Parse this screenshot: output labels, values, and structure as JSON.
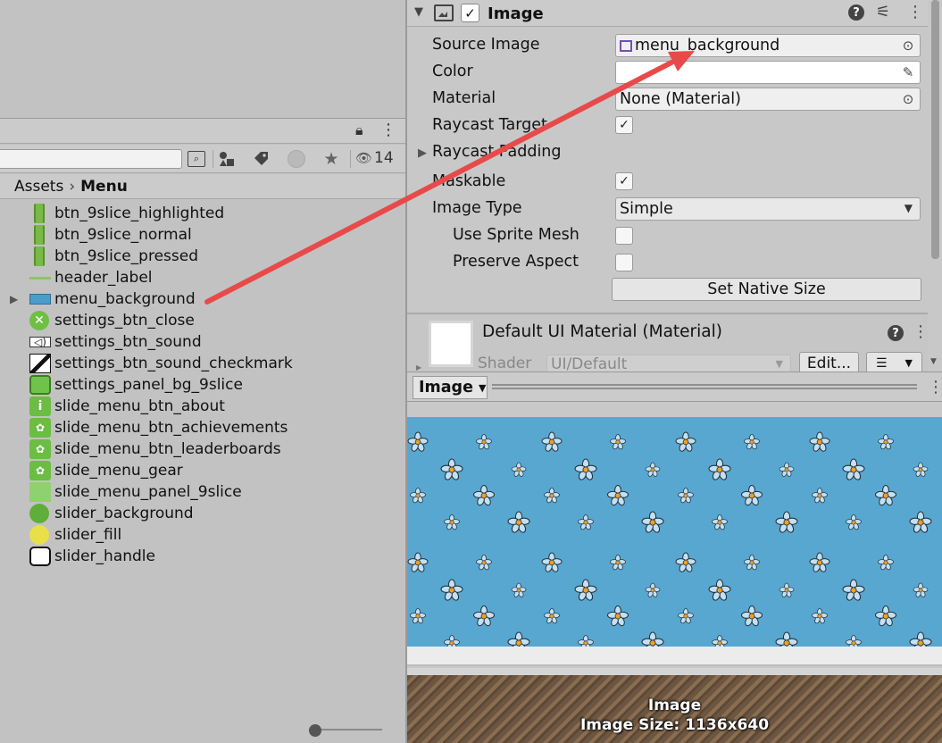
{
  "project": {
    "tabbar": {
      "lock_icon": "lock-icon",
      "menu_icon": "kebab-icon"
    },
    "toolbar": {
      "search_value": "",
      "visible_count": "14",
      "icons": [
        "search-window-icon",
        "type-filter-icon",
        "label-filter-icon",
        "log-filter-icon",
        "favorite-star-icon",
        "eye-icon"
      ]
    },
    "breadcrumb": {
      "root": "Assets",
      "separator": "›",
      "current": "Menu"
    },
    "assets": [
      {
        "name": "btn_9slice_highlighted",
        "thumb": "vbar"
      },
      {
        "name": "btn_9slice_normal",
        "thumb": "vbar"
      },
      {
        "name": "btn_9slice_pressed",
        "thumb": "vbar"
      },
      {
        "name": "header_label",
        "thumb": "hline"
      },
      {
        "name": "menu_background",
        "thumb": "blue",
        "expandable": true
      },
      {
        "name": "settings_btn_close",
        "thumb": "close"
      },
      {
        "name": "settings_btn_sound",
        "thumb": "sound"
      },
      {
        "name": "settings_btn_sound_checkmark",
        "thumb": "check"
      },
      {
        "name": "settings_panel_bg_9slice",
        "thumb": "panel9"
      },
      {
        "name": "slide_menu_btn_about",
        "thumb": "about"
      },
      {
        "name": "slide_menu_btn_achievements",
        "thumb": "green"
      },
      {
        "name": "slide_menu_btn_leaderboards",
        "thumb": "green"
      },
      {
        "name": "slide_menu_gear",
        "thumb": "green"
      },
      {
        "name": "slide_menu_panel_9slice",
        "thumb": "flat"
      },
      {
        "name": "slider_background",
        "thumb": "circle"
      },
      {
        "name": "slider_fill",
        "thumb": "yellow"
      },
      {
        "name": "slider_handle",
        "thumb": "handle"
      }
    ]
  },
  "inspector": {
    "component": {
      "title": "Image",
      "enabled": true
    },
    "props": {
      "source_image_label": "Source Image",
      "source_image_value": "menu_background",
      "color_label": "Color",
      "material_label": "Material",
      "material_value": "None (Material)",
      "raycast_target_label": "Raycast Target",
      "raycast_target_checked": true,
      "raycast_padding_label": "Raycast Padding",
      "maskable_label": "Maskable",
      "maskable_checked": true,
      "image_type_label": "Image Type",
      "image_type_value": "Simple",
      "use_sprite_mesh_label": "Use Sprite Mesh",
      "use_sprite_mesh_checked": false,
      "preserve_aspect_label": "Preserve Aspect",
      "preserve_aspect_checked": false,
      "set_native_size_label": "Set Native Size"
    },
    "material_section": {
      "name": "Default UI Material (Material)",
      "shader_label": "Shader",
      "shader_value": "UI/Default",
      "edit_label": "Edit..."
    }
  },
  "preview": {
    "dropdown_label": "Image",
    "caption_title": "Image",
    "caption_size": "Image Size: 1136x640",
    "colors": {
      "sky": "#5aa5cf",
      "petal": "#b9dcf2",
      "center": "#f0a020",
      "wood": "#7a6048"
    }
  },
  "annotation": {
    "color": "#e84a4a",
    "from": "menu_background asset",
    "to": "Source Image field"
  }
}
